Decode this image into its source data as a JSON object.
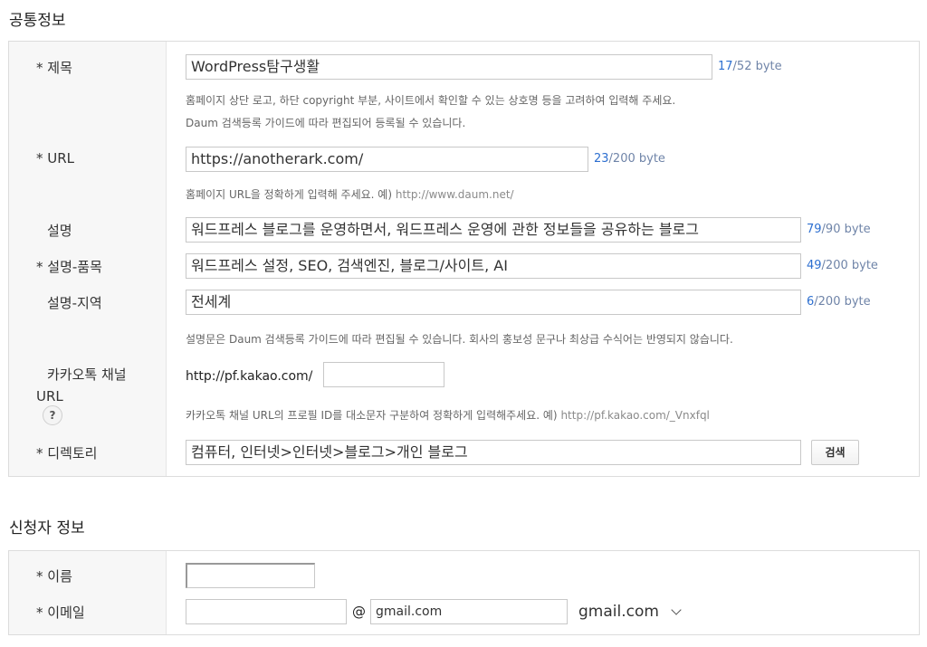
{
  "sections": {
    "common": {
      "title": "공통정보"
    },
    "applicant": {
      "title": "신청자 정보"
    }
  },
  "common": {
    "title_label": "* 제목",
    "title_value": "WordPress탐구생활",
    "title_count": "17",
    "title_max": "/52 byte",
    "title_help1": "홈페이지 상단 로고, 하단 copyright 부분, 사이트에서 확인할 수 있는 상호명 등을 고려하여 입력해 주세요.",
    "title_help2": "Daum 검색등록 가이드에 따라 편집되어 등록될 수 있습니다.",
    "url_label": "* URL",
    "url_value": "https://anotherark.com/",
    "url_count": "23",
    "url_max": "/200 byte",
    "url_help": "홈페이지 URL을 정확하게 입력해 주세요. 예)",
    "url_help_example": "http://www.daum.net/",
    "desc_label": "설명",
    "desc_value": "워드프레스 블로그를 운영하면서, 워드프레스 운영에 관한 정보들을 공유하는 블로그",
    "desc_count": "79",
    "desc_max": "/90 byte",
    "product_label": "* 설명-품목",
    "product_value": "워드프레스 설정, SEO, 검색엔진, 블로그/사이트, AI",
    "product_count": "49",
    "product_max": "/200 byte",
    "region_label": "설명-지역",
    "region_value": "전세계",
    "region_count": "6",
    "region_max": "/200 byte",
    "desc_help": "설명문은 Daum 검색등록 가이드에 따라 편집될 수 있습니다. 회사의 홍보성 문구나 최상급 수식어는 반영되지 않습니다.",
    "kakao_label_line1": "카카오톡 채널",
    "kakao_label_line2": "URL",
    "kakao_help_icon": "?",
    "kakao_prefix": "http://pf.kakao.com/",
    "kakao_value": "",
    "kakao_help": "카카오톡 채널 URL의 프로필 ID를 대소문자 구분하여 정확하게 입력해주세요. 예)",
    "kakao_help_example": "http://pf.kakao.com/_Vnxfql",
    "dir_label": "* 디렉토리",
    "dir_value": "컴퓨터, 인터넷>인터넷>블로그>개인 블로그",
    "search_button": "검색"
  },
  "applicant": {
    "name_label": "* 이름",
    "name_value": "",
    "email_label": "* 이메일",
    "email_user": "",
    "at": "@",
    "email_domain": "gmail.com",
    "email_domain_select": "gmail.com"
  },
  "icons": {
    "help": "question-circle-icon",
    "dropdown": "chevron-down-icon"
  },
  "colors": {
    "count_current": "#2d6fd0",
    "count_max": "#6f84a8",
    "label_bg": "#f7f7f7",
    "border": "#dcdcdc"
  }
}
